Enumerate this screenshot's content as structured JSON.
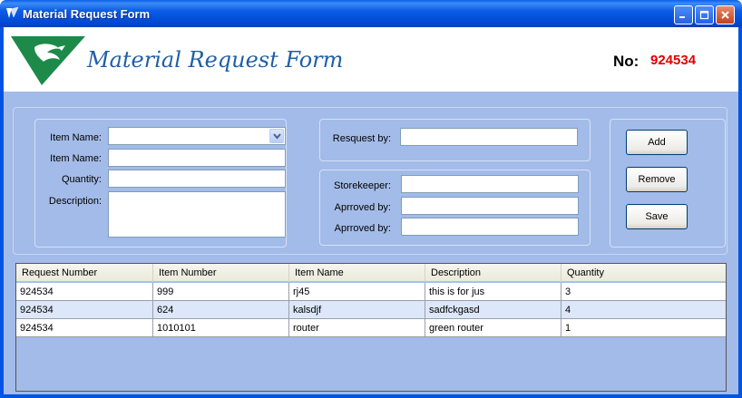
{
  "window": {
    "title": "Material Request Form"
  },
  "header": {
    "form_title": "Material Request Form",
    "no_label": "No:",
    "no_value": "924534",
    "no_color": "#e00000",
    "title_color": "#1f5fa8"
  },
  "item_group": {
    "item_name_select_label": "Item Name:",
    "item_name_select_value": "",
    "item_name_label": "Item Name:",
    "item_name_value": "",
    "quantity_label": "Quantity:",
    "quantity_value": "",
    "description_label": "Description:",
    "description_value": ""
  },
  "request_group": {
    "requested_by_label": "Resquest by:",
    "requested_by_value": ""
  },
  "approval_group": {
    "storekeeper_label": "Storekeeper:",
    "storekeeper_value": "",
    "approved_by_1_label": "Aprroved by:",
    "approved_by_1_value": "",
    "approved_by_2_label": "Aprroved by:",
    "approved_by_2_value": ""
  },
  "actions": {
    "add": "Add",
    "remove": "Remove",
    "save": "Save"
  },
  "grid": {
    "columns": [
      "Request Number",
      "Item Number",
      "Item Name",
      "Description",
      "Quantity"
    ],
    "rows": [
      [
        "924534",
        "999",
        "rj45",
        "this is for jus",
        "3"
      ],
      [
        "924534",
        "624",
        "kalsdjf",
        "sadfckgasd",
        "4"
      ],
      [
        "924534",
        "1010101",
        "router",
        "green router",
        "1"
      ]
    ]
  }
}
